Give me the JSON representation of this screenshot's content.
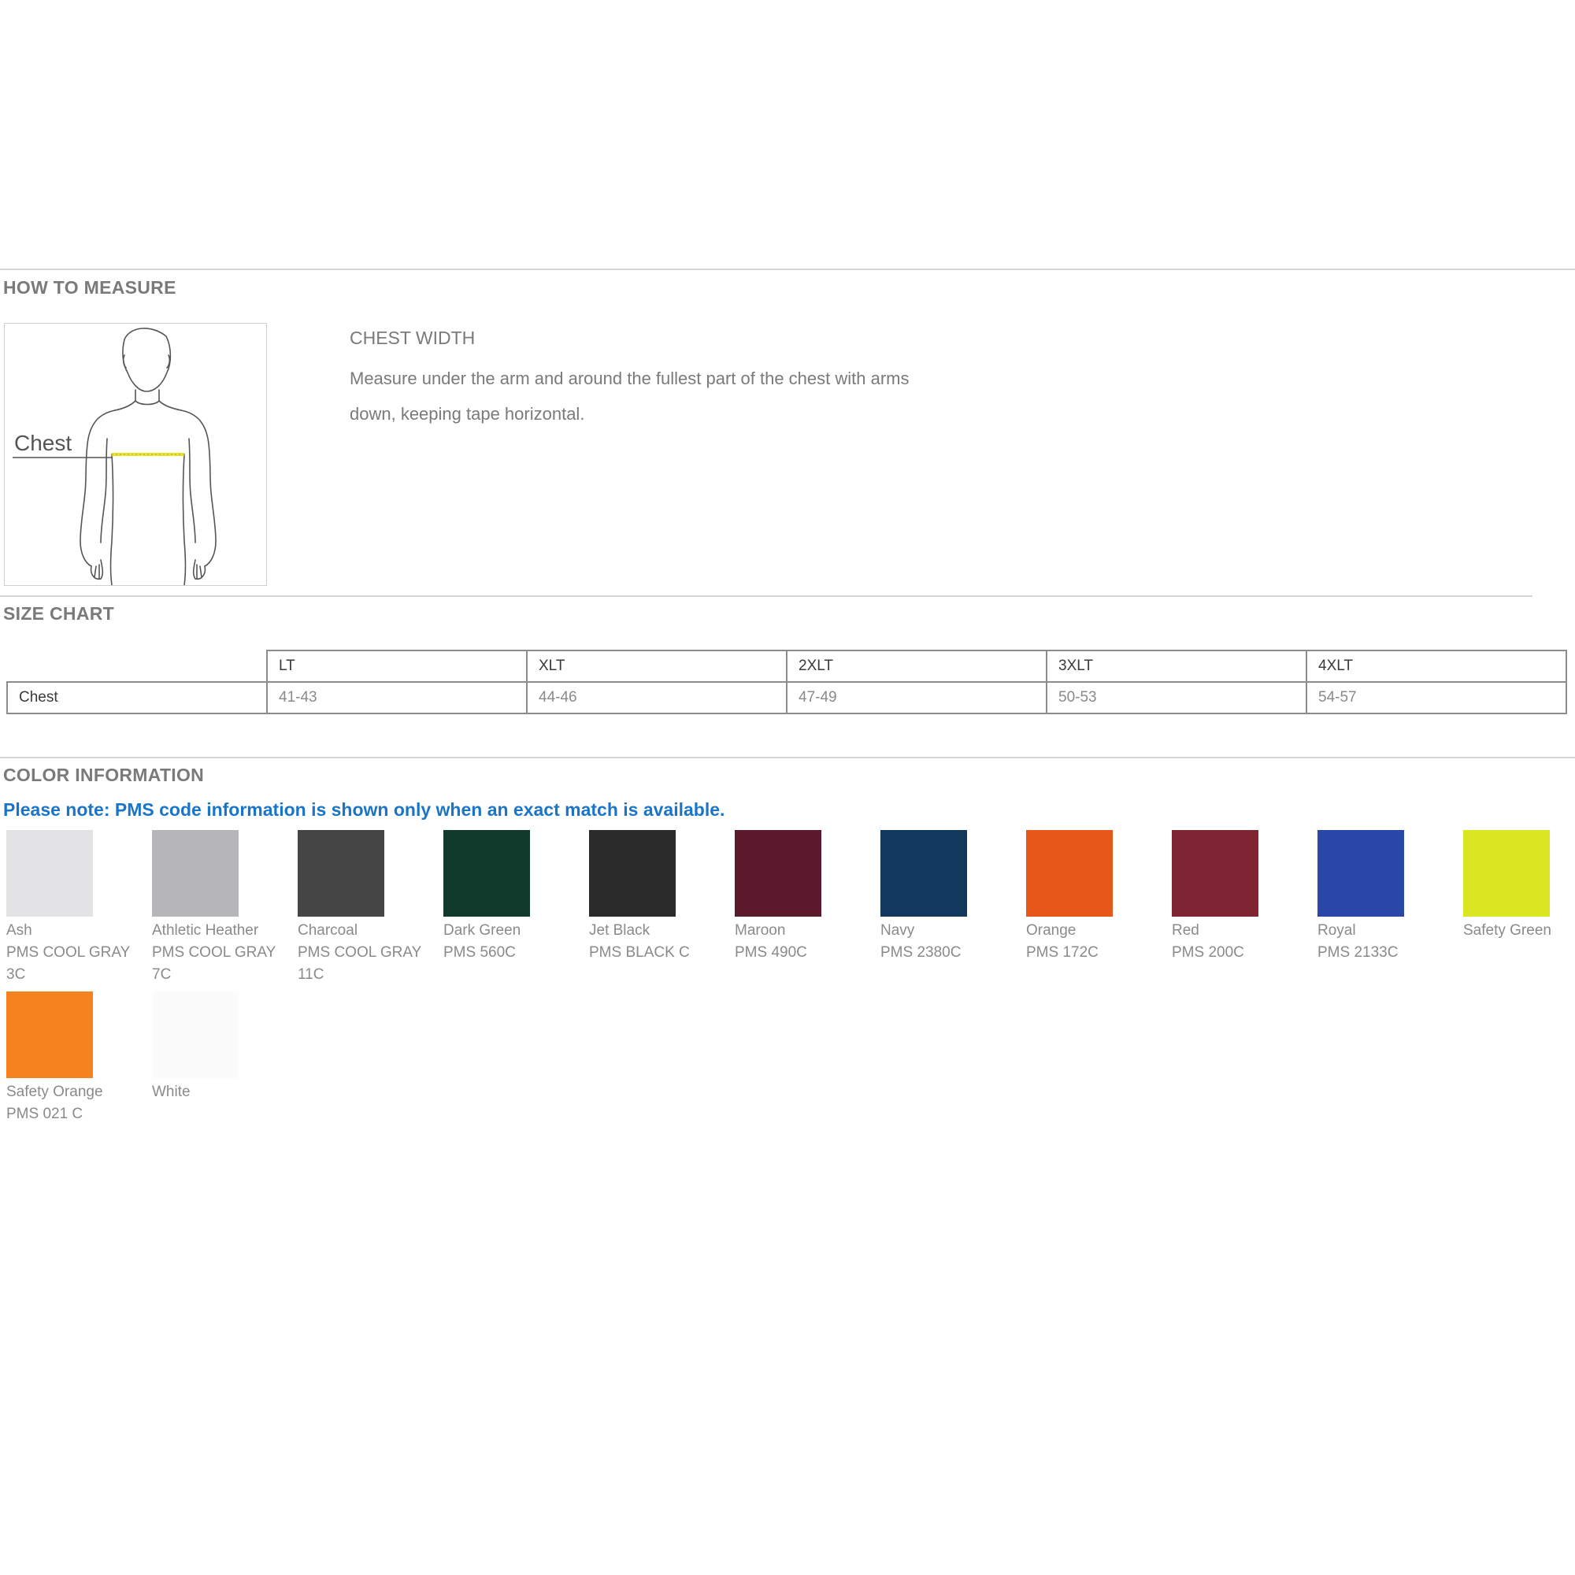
{
  "how_to_measure": {
    "title": "HOW TO MEASURE",
    "figure_label": "Chest",
    "heading": "CHEST WIDTH",
    "description": "Measure under the arm and around the fullest part of the chest with arms down, keeping tape horizontal."
  },
  "size_chart": {
    "title": "SIZE CHART",
    "row_label": "Chest",
    "sizes": [
      "LT",
      "XLT",
      "2XLT",
      "3XLT",
      "4XLT"
    ],
    "chest": [
      "41-43",
      "44-46",
      "47-49",
      "50-53",
      "54-57"
    ]
  },
  "color_information": {
    "title": "COLOR INFORMATION",
    "note": "Please note: PMS code information is shown only when an exact match is available.",
    "swatches": [
      {
        "name": "Ash",
        "pms": "PMS COOL GRAY 3C",
        "color": "#e3e3e5"
      },
      {
        "name": "Athletic Heather",
        "pms": "PMS COOL GRAY 7C",
        "color": "#b6b6b8"
      },
      {
        "name": "Charcoal",
        "pms": "PMS COOL GRAY 11C",
        "color": "#454545"
      },
      {
        "name": "Dark Green",
        "pms": "PMS 560C",
        "color": "#0f3a2c"
      },
      {
        "name": "Jet Black",
        "pms": "PMS BLACK C",
        "color": "#2a2a2a"
      },
      {
        "name": "Maroon",
        "pms": "PMS 490C",
        "color": "#5a1a2c"
      },
      {
        "name": "Navy",
        "pms": "PMS 2380C",
        "color": "#13385e"
      },
      {
        "name": "Orange",
        "pms": "PMS 172C",
        "color": "#e8571a"
      },
      {
        "name": "Red",
        "pms": "PMS 200C",
        "color": "#7e2433"
      },
      {
        "name": "Royal",
        "pms": "PMS 2133C",
        "color": "#2847a8"
      },
      {
        "name": "Safety Green",
        "pms": "",
        "color": "#dbe623"
      },
      {
        "name": "Safety Orange",
        "pms": "PMS 021 C",
        "color": "#f5821f"
      },
      {
        "name": "White",
        "pms": "",
        "color": "#fbfbfb"
      }
    ]
  }
}
